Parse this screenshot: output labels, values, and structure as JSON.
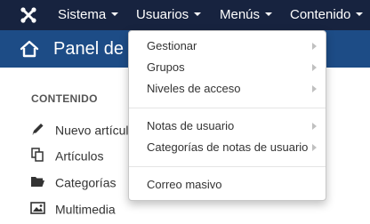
{
  "topbar": {
    "logo_icon": "joomla-logo-icon",
    "menus": [
      {
        "label": "Sistema"
      },
      {
        "label": "Usuarios"
      },
      {
        "label": "Menús"
      },
      {
        "label": "Contenido"
      }
    ]
  },
  "subheader": {
    "home_icon": "home-icon",
    "title": "Panel de"
  },
  "sidebar": {
    "section_label": "CONTENIDO",
    "items": [
      {
        "label": "Nuevo artícul",
        "icon": "pencil-icon"
      },
      {
        "label": "Artículos",
        "icon": "copy-icon"
      },
      {
        "label": "Categorías",
        "icon": "folder-open-icon"
      },
      {
        "label": "Multimedia",
        "icon": "image-icon"
      }
    ]
  },
  "usuarios_dropdown": {
    "items": [
      {
        "label": "Gestionar",
        "has_submenu": true
      },
      {
        "label": "Grupos",
        "has_submenu": true
      },
      {
        "label": "Niveles de acceso",
        "has_submenu": true
      },
      {
        "label": "Notas de usuario",
        "has_submenu": true
      },
      {
        "label": "Categorías de notas de usuario",
        "has_submenu": true
      },
      {
        "label": "Correo masivo",
        "has_submenu": false
      }
    ]
  },
  "colors": {
    "topbar_bg": "#17233f",
    "subheader_bg": "#1d4c86",
    "dropdown_bg": "#ffffff"
  }
}
